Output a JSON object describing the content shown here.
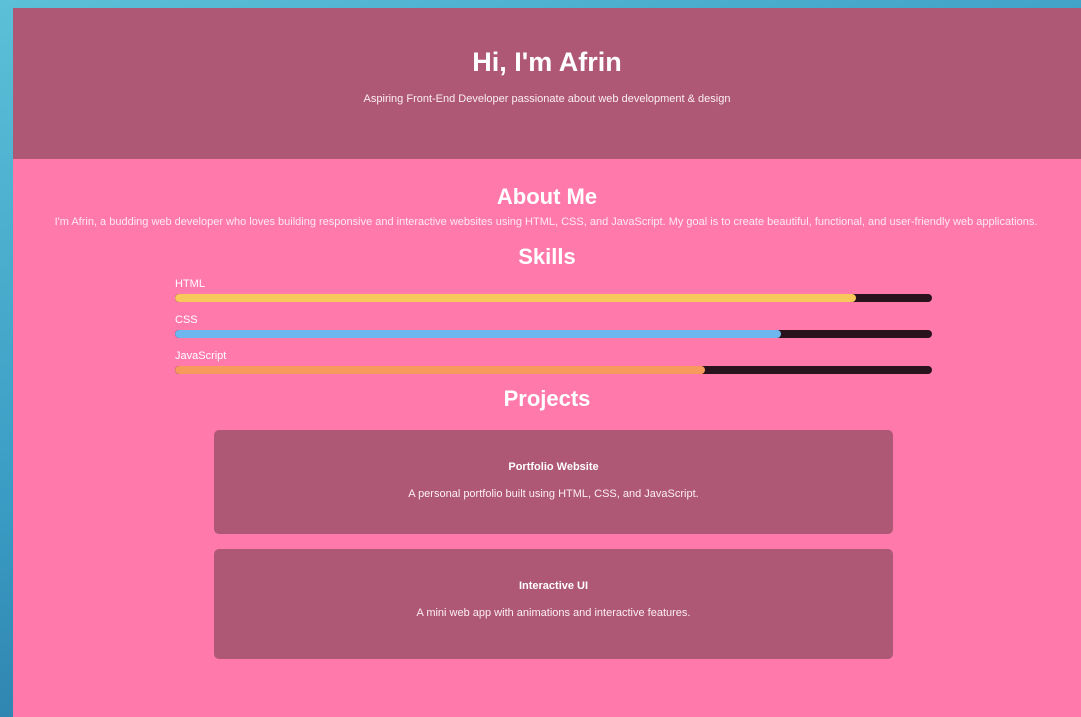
{
  "header": {
    "title": "Hi, I'm Afrin",
    "subtitle": "Aspiring Front-End Developer passionate about web development & design"
  },
  "about": {
    "title": "About Me",
    "text": "I'm Afrin, a budding web developer who loves building responsive and interactive websites using HTML, CSS, and JavaScript. My goal is to create beautiful, functional, and user-friendly web applications."
  },
  "skills": {
    "title": "Skills",
    "items": [
      {
        "name": "HTML",
        "level": 0.9,
        "color": "#f8c95a"
      },
      {
        "name": "CSS",
        "level": 0.8,
        "color": "#6cb8ee"
      },
      {
        "name": "JavaScript",
        "level": 0.7,
        "color": "#f79a5e"
      }
    ]
  },
  "projects": {
    "title": "Projects",
    "items": [
      {
        "name": "Portfolio Website",
        "description": "A personal portfolio built using HTML, CSS, and JavaScript."
      },
      {
        "name": "Interactive UI",
        "description": "A mini web app with animations and interactive features."
      }
    ]
  },
  "colors": {
    "page_background": "#ff7aab",
    "header_background": "#af5875",
    "bar_track": "#2a121c"
  }
}
